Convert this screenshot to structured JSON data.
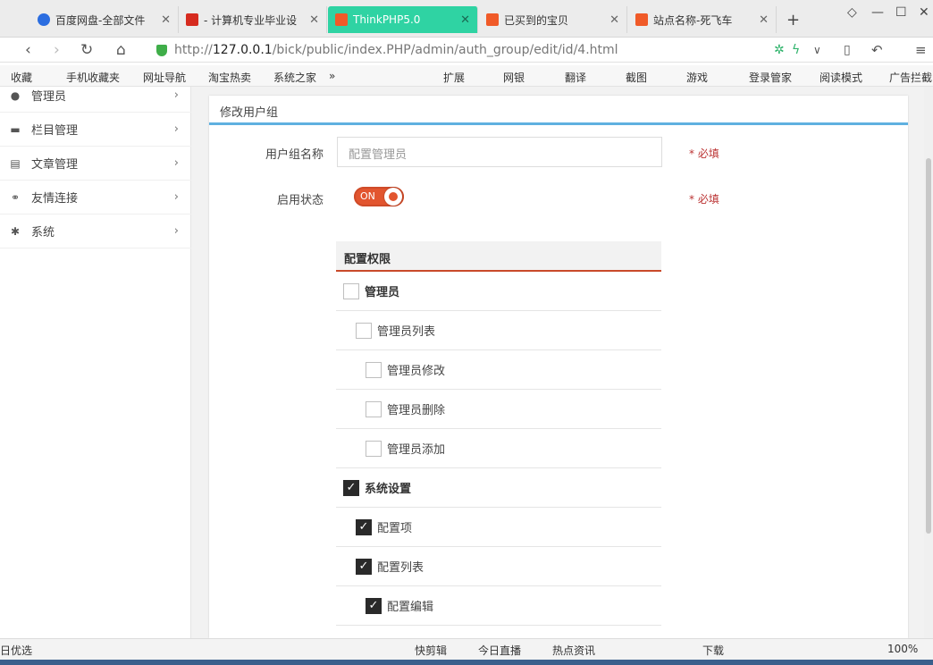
{
  "browser": {
    "tabs": [
      {
        "label": "百度网盘-全部文件",
        "icon": "baidu-cloud-icon",
        "color": "#2b6de0"
      },
      {
        "label": "- 计算机专业毕业设",
        "icon": "red-square-icon",
        "color": "#d62b1f"
      },
      {
        "label": "ThinkPHP5.0",
        "icon": "thinkphp-icon",
        "color": "#f05a28",
        "active": true
      },
      {
        "label": "已买到的宝贝",
        "icon": "taobao-icon",
        "color": "#f05a28"
      },
      {
        "label": "站点名称-死飞车",
        "icon": "thinkphp-icon",
        "color": "#f05a28"
      }
    ],
    "url_prefix": "http://",
    "url_host": "127.0.0.1",
    "url_path": "/bick/public/index.PHP/admin/auth_group/edit/id/4.html"
  },
  "bookmarks": [
    "收藏",
    "手机收藏夹",
    "网址导航",
    "淘宝热卖",
    "系统之家",
    "»",
    "扩展",
    "网银",
    "翻译",
    "截图",
    "游戏",
    "登录管家",
    "阅读模式",
    "广告拦截"
  ],
  "sidebar": {
    "items": [
      {
        "label": "管理员",
        "icon": "user-icon"
      },
      {
        "label": "栏目管理",
        "icon": "folder-icon"
      },
      {
        "label": "文章管理",
        "icon": "document-icon"
      },
      {
        "label": "友情连接",
        "icon": "link-icon"
      },
      {
        "label": "系统",
        "icon": "gear-icon"
      }
    ]
  },
  "panel": {
    "title": "修改用户组",
    "group_name_label": "用户组名称",
    "group_name_placeholder": "配置管理员",
    "status_label": "启用状态",
    "status_toggle": "ON",
    "required": "* 必填",
    "perm_header": "配置权限",
    "permissions": [
      {
        "label": "管理员",
        "checked": false,
        "level": 0
      },
      {
        "label": "管理员列表",
        "checked": false,
        "level": 1
      },
      {
        "label": "管理员修改",
        "checked": false,
        "level": 2
      },
      {
        "label": "管理员删除",
        "checked": false,
        "level": 2
      },
      {
        "label": "管理员添加",
        "checked": false,
        "level": 2
      },
      {
        "label": "系统设置",
        "checked": true,
        "level": 0
      },
      {
        "label": "配置项",
        "checked": true,
        "level": 1
      },
      {
        "label": "配置列表",
        "checked": true,
        "level": 1
      },
      {
        "label": "配置编辑",
        "checked": true,
        "level": 2
      }
    ]
  },
  "statusbar": [
    "日优选",
    "快剪辑",
    "今日直播",
    "热点资讯",
    "下载",
    "100%"
  ],
  "colors": {
    "accent": "#e2552f",
    "active_tab": "#2fd3a3",
    "panel_line": "#5fb0e0"
  }
}
